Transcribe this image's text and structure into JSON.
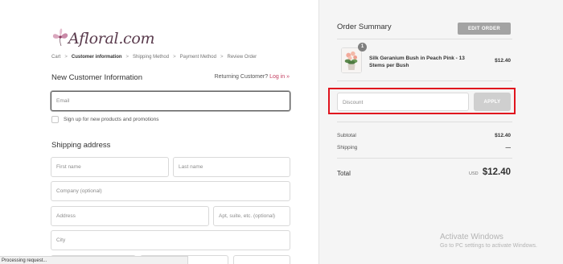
{
  "brand": {
    "name": "Afloral.com"
  },
  "breadcrumb": [
    {
      "label": "Cart",
      "active": false
    },
    {
      "label": "Customer information",
      "active": true
    },
    {
      "label": "Shipping Method",
      "active": false
    },
    {
      "label": "Payment Method",
      "active": false
    },
    {
      "label": "Review Order",
      "active": false
    }
  ],
  "customer": {
    "title": "New Customer Information",
    "returning_text": "Returning Customer?",
    "login_link": "Log in »",
    "email_placeholder": "Email",
    "signup_label": "Sign up for new products and promotions"
  },
  "shipping": {
    "title": "Shipping address",
    "first_name_placeholder": "First name",
    "last_name_placeholder": "Last name",
    "company_placeholder": "Company (optional)",
    "address_placeholder": "Address",
    "apt_placeholder": "Apt, suite, etc. (optional)",
    "city_placeholder": "City"
  },
  "status_bar": {
    "text": "Processing request..."
  },
  "summary": {
    "title": "Order Summary",
    "edit_label": "EDIT ORDER",
    "item": {
      "name": "Silk Geranium Bush in Peach Pink - 13 Stems per Bush",
      "qty": "1",
      "price": "$12.40"
    },
    "discount_placeholder": "Discount",
    "apply_label": "APPLY",
    "subtotal_label": "Subtotal",
    "subtotal_value": "$12.40",
    "shipping_label": "Shipping",
    "shipping_value": "—",
    "total_label": "Total",
    "total_currency": "USD",
    "total_value": "$12.40"
  },
  "watermark": {
    "line1": "Activate Windows",
    "line2": "Go to PC settings to activate Windows."
  },
  "colors": {
    "accent_link": "#c23b5e",
    "highlight_border": "#e0141e",
    "button_gray": "#a3a3a3"
  }
}
